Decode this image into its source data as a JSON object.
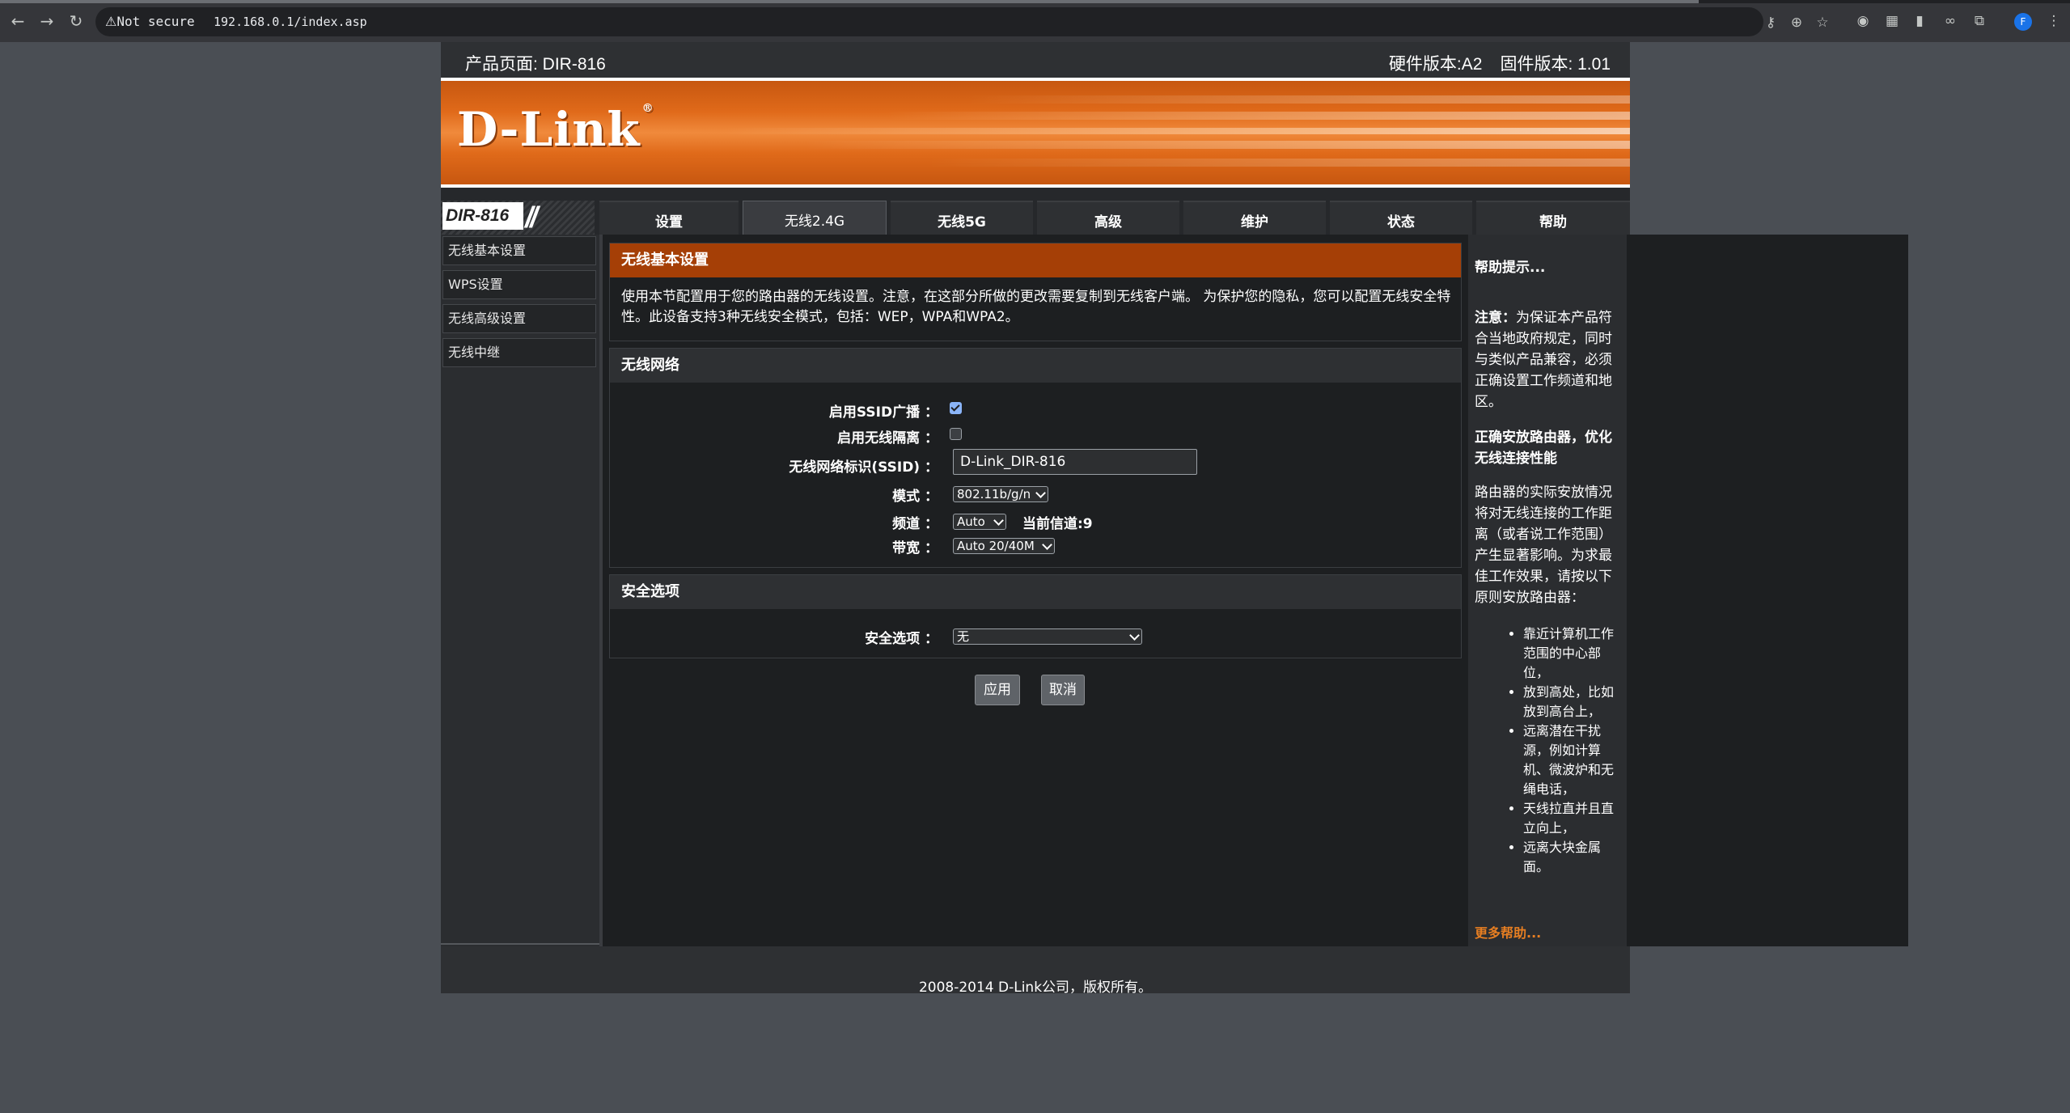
{
  "browser": {
    "security_label": "Not secure",
    "url": "192.168.0.1/index.asp"
  },
  "header": {
    "product_page": "产品页面: DIR-816",
    "hardware_version": "硬件版本:A2",
    "firmware_version": "固件版本: 1.01"
  },
  "banner": {
    "logo_text": "D-Link",
    "model_badge": "DIR-816"
  },
  "tabs": [
    {
      "label": "设置"
    },
    {
      "label": "无线2.4G"
    },
    {
      "label": "无线5G"
    },
    {
      "label": "高级"
    },
    {
      "label": "维护"
    },
    {
      "label": "状态"
    },
    {
      "label": "帮助"
    }
  ],
  "sidebar": {
    "items": [
      {
        "label": "无线基本设置"
      },
      {
        "label": "WPS设置"
      },
      {
        "label": "无线高级设置"
      },
      {
        "label": "无线中继"
      }
    ]
  },
  "main": {
    "title": "无线基本设置",
    "intro": "使用本节配置用于您的路由器的无线设置。注意，在这部分所做的更改需要复制到无线客户端。 为保护您的隐私，您可以配置无线安全特性。此设备支持3种无线安全模式，包括：WEP，WPA和WPA2。",
    "network_section": {
      "title": "无线网络",
      "ssid_broadcast_label": "启用SSID广播 ：",
      "ssid_broadcast_checked": true,
      "isolation_label": "启用无线隔离 ：",
      "isolation_checked": false,
      "ssid_label": "无线网络标识(SSID) ：",
      "ssid_value": "D-Link_DIR-816",
      "mode_label": "模式 ：",
      "mode_value": "802.11b/g/n",
      "channel_label": "频道 ：",
      "channel_value": "Auto",
      "current_channel": "当前信道:9",
      "bandwidth_label": "带宽 ：",
      "bandwidth_value": "Auto 20/40M"
    },
    "security_section": {
      "title": "安全选项",
      "security_label": "安全选项 ：",
      "security_value": "无"
    },
    "apply_label": "应用",
    "cancel_label": "取消"
  },
  "help": {
    "title": "帮助提示...",
    "note_bold": "注意：",
    "note_text": "为保证本产品符合当地政府规定，同时与类似产品兼容，必须正确设置工作频道和地区。",
    "placement_title": "正确安放路由器，优化无线连接性能",
    "placement_text": "路由器的实际安放情况将对无线连接的工作距离（或者说工作范围）产生显著影响。为求最佳工作效果，请按以下原则安放路由器：",
    "tips": [
      "靠近计算机工作范围的中心部位，",
      "放到高处，比如放到高台上，",
      "远离潜在干扰源，例如计算机、微波炉和无绳电话，",
      "天线拉直并且直立向上，",
      "远离大块金属面。"
    ],
    "more_help": "更多帮助..."
  },
  "footer": {
    "copyright": "2008-2014 D-Link公司，版权所有。"
  },
  "colors": {
    "accent_orange": "#e06a1a",
    "section_header_orange": "#a53f06",
    "page_bg": "#4a4e54"
  }
}
